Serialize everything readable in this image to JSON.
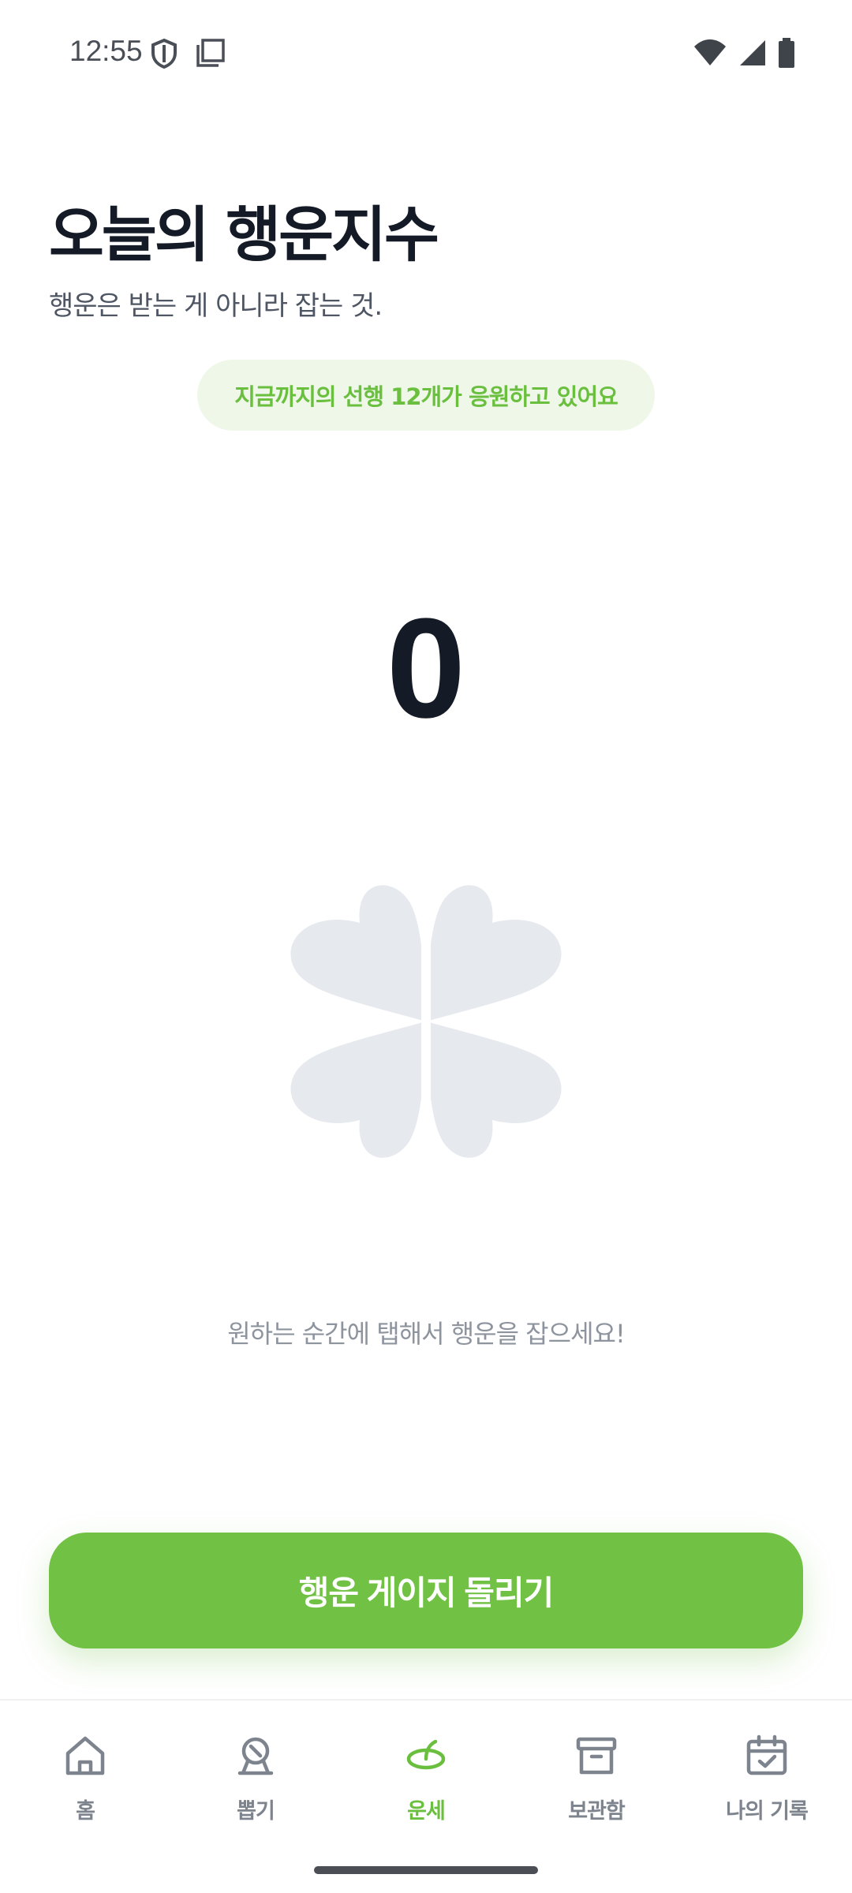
{
  "status_bar": {
    "time": "12:55",
    "icons": [
      "shield-icon",
      "screenshot-icon",
      "wifi-icon",
      "signal-icon",
      "battery-icon"
    ]
  },
  "header": {
    "title": "오늘의 행운지수",
    "subtitle": "행운은 받는 게 아니라 잡는 것."
  },
  "cheer_badge": "지금까지의 선행 12개가 응원하고 있어요",
  "luck_score": "0",
  "clover_icon": "clover-icon",
  "tap_hint": "원하는 순간에 탭해서 행운을 잡으세요!",
  "spin_button_label": "행운 게이지 돌리기",
  "nav": {
    "active": "fortune",
    "items": [
      {
        "label": "홈",
        "icon": "home-icon"
      },
      {
        "label": "뽑기",
        "icon": "gacha-icon"
      },
      {
        "label": "운세",
        "icon": "fortune-icon"
      },
      {
        "label": "보관함",
        "icon": "archive-icon"
      },
      {
        "label": "나의 기록",
        "icon": "calendar-check-icon"
      }
    ]
  },
  "colors": {
    "accent": "#70c144",
    "accent_text": "#6bbf3f",
    "badge_bg": "#eef7e8",
    "clover": "#e6e9ee",
    "title": "#141a26",
    "muted": "#8e949e"
  }
}
